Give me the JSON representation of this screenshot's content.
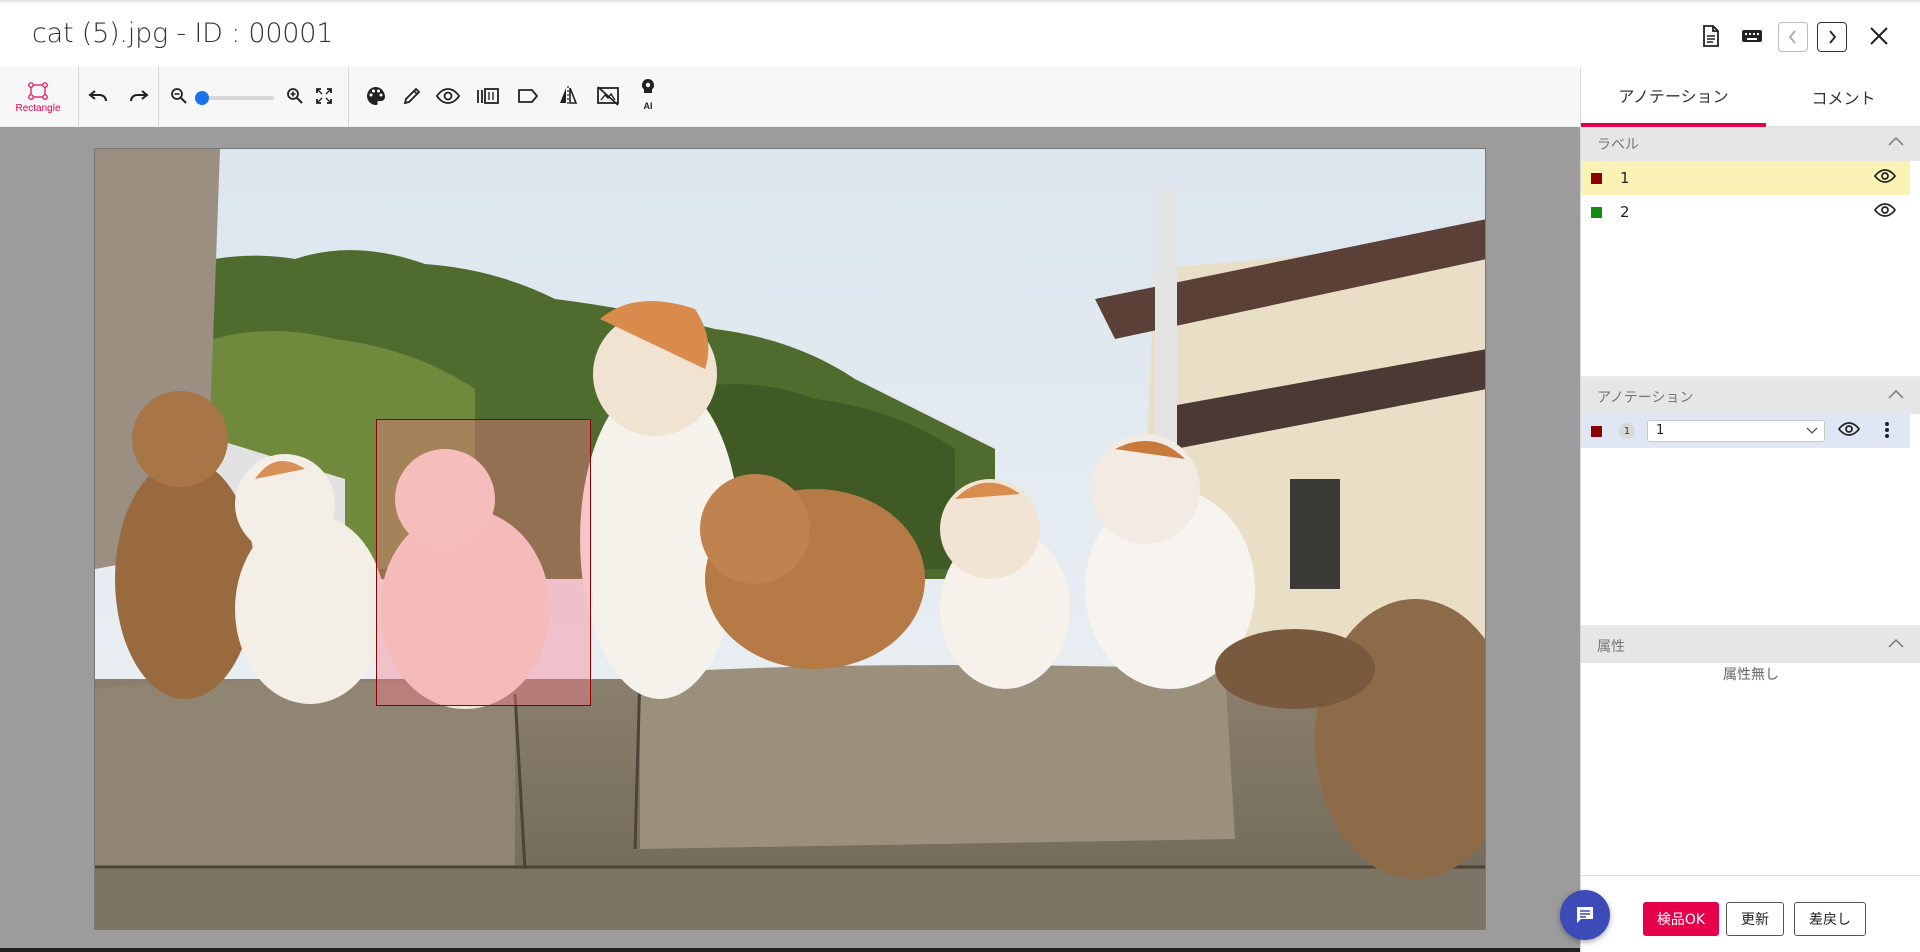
{
  "header": {
    "title": "cat (5).jpg - ID : 00001",
    "icons": [
      "document-icon",
      "keyboard-icon",
      "chevron-left-icon",
      "chevron-right-icon",
      "close-icon"
    ]
  },
  "toolbar": {
    "rectangle_label": "Rectangle",
    "ai_label": "AI",
    "zoom_level": 0.0,
    "icons": [
      "rectangle-icon",
      "undo-icon",
      "redo-icon",
      "zoom-out-icon",
      "zoom-in-icon",
      "fit-screen-icon",
      "palette-icon",
      "pencil-icon",
      "eye-icon",
      "library-icon",
      "label-icon",
      "flip-icon",
      "no-image-icon",
      "ai-icon"
    ]
  },
  "tabs": [
    {
      "label": "アノテーション",
      "active": true
    },
    {
      "label": "コメント",
      "active": false
    }
  ],
  "labels_section": {
    "title": "ラベル",
    "items": [
      {
        "label": "1",
        "color": "#8b0000",
        "selected": true
      },
      {
        "label": "2",
        "color": "#138a13",
        "selected": false
      }
    ]
  },
  "annotations_section": {
    "title": "アノテーション",
    "items": [
      {
        "index": "1",
        "label": "1",
        "color": "#8b0000"
      }
    ]
  },
  "attributes_section": {
    "title": "属性",
    "empty_text": "属性無し"
  },
  "footer": {
    "approve_label": "検品OK",
    "update_label": "更新",
    "reject_label": "差戻し"
  },
  "colors": {
    "accent": "#e6004c",
    "canvas_bg": "#9c9c9c",
    "selected_label_bg": "#fbf3b5",
    "selected_annotation_bg": "#dfe6f4",
    "chat_fab": "#3d4bb8"
  }
}
